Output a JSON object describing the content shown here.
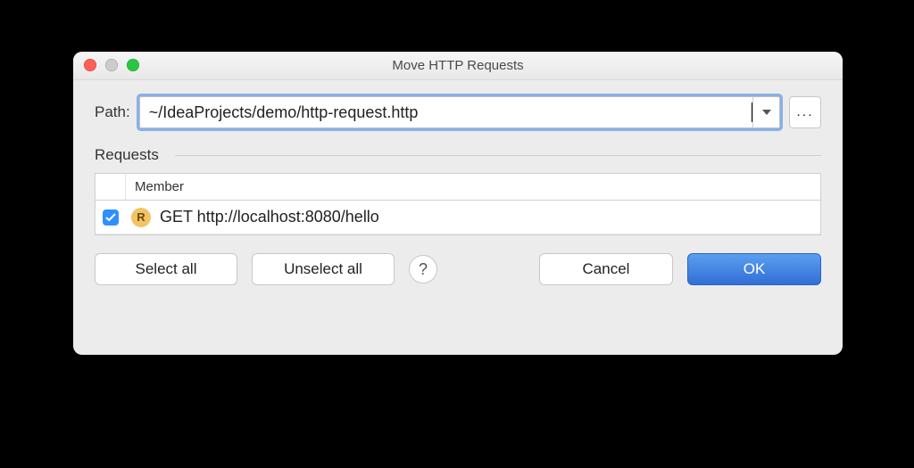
{
  "window": {
    "title": "Move HTTP Requests"
  },
  "path": {
    "label": "Path:",
    "value": "~/IdeaProjects/demo/http-request.http",
    "browse": "..."
  },
  "requests": {
    "group_label": "Requests",
    "columns": {
      "member": "Member"
    },
    "items": [
      {
        "checked": true,
        "badge": "R",
        "label": "GET http://localhost:8080/hello"
      }
    ]
  },
  "buttons": {
    "select_all": "Select all",
    "unselect_all": "Unselect all",
    "help": "?",
    "cancel": "Cancel",
    "ok": "OK"
  }
}
